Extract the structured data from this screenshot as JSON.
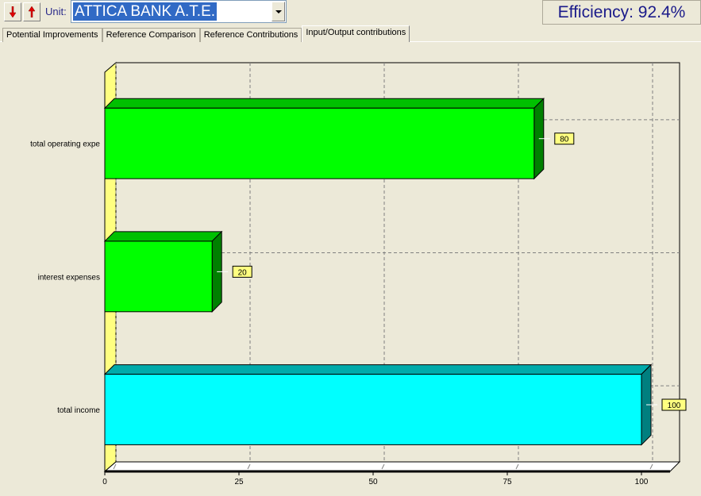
{
  "toolbar": {
    "prev_icon": "arrow-down-icon",
    "next_icon": "arrow-up-icon",
    "unit_label": "Unit:",
    "unit_value": "ATTICA BANK A.T.E.",
    "efficiency": "Efficiency: 92.4%"
  },
  "tabs": [
    {
      "label": "Potential Improvements"
    },
    {
      "label": "Reference Comparison"
    },
    {
      "label": "Reference Contributions"
    },
    {
      "label": "Input/Output contributions",
      "active": true
    }
  ],
  "chart_data": {
    "type": "bar",
    "orientation": "horizontal",
    "3d": true,
    "categories": [
      "total operating expe",
      "interest expenses",
      "total income"
    ],
    "values": [
      80,
      20,
      100
    ],
    "colors": [
      "#00ff00",
      "#00ff00",
      "#00ffff"
    ],
    "xlim": [
      0,
      100
    ],
    "xticks": [
      0,
      25,
      50,
      75,
      100
    ],
    "grid": true
  }
}
